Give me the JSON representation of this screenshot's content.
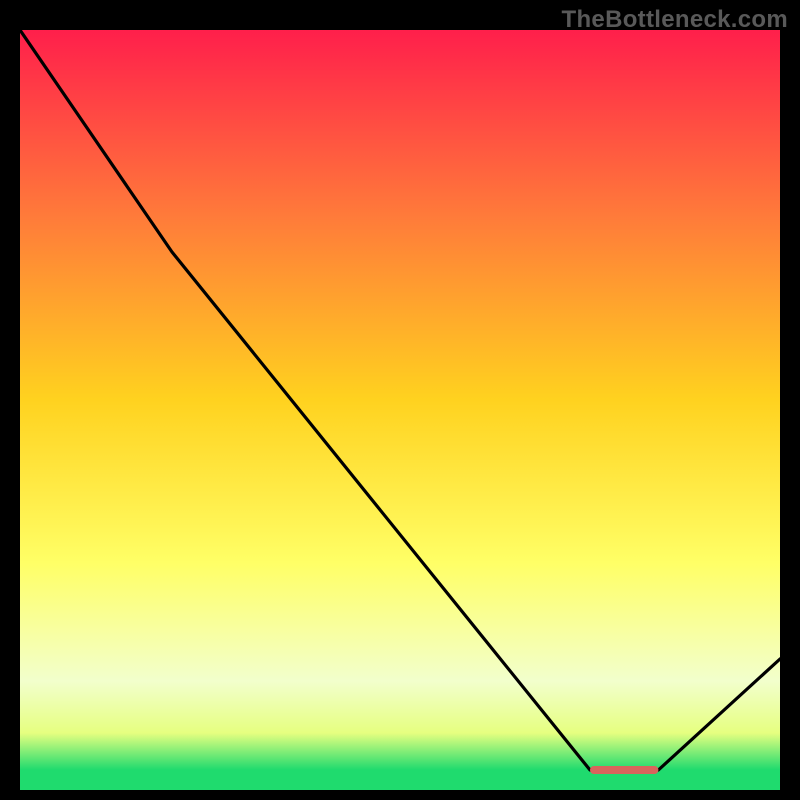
{
  "watermark": "TheBottleneck.com",
  "chart_data": {
    "type": "line",
    "title": "",
    "xlabel": "",
    "ylabel": "",
    "xlim": [
      0,
      100
    ],
    "ylim": [
      0,
      100
    ],
    "x": [
      0,
      20,
      75,
      84,
      100
    ],
    "values": [
      100,
      70,
      0,
      0,
      15
    ],
    "marker_segment": {
      "x_start": 75,
      "x_end": 84,
      "y": 0
    },
    "colors": {
      "gradient_top": "#ff1f4b",
      "gradient_mid_upper": "#ff7a3a",
      "gradient_mid": "#ffd21f",
      "gradient_mid_lower": "#ffff66",
      "gradient_lower": "#f2ffcc",
      "gradient_base_yellow": "#e6ff80",
      "gradient_base_green": "#1fdb6e",
      "line": "#000000",
      "marker": "#d9645c",
      "background": "#000000"
    }
  }
}
